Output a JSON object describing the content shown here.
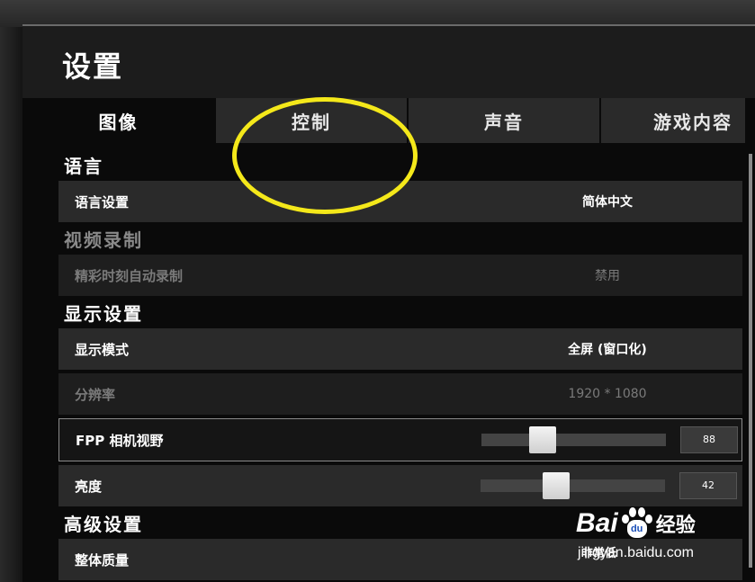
{
  "header": {
    "title": "设置"
  },
  "tabs": [
    {
      "label": "图像",
      "active": true
    },
    {
      "label": "控制",
      "active": false
    },
    {
      "label": "声音",
      "active": false
    },
    {
      "label": "游戏内容",
      "active": false
    }
  ],
  "sections": {
    "language": {
      "title": "语言",
      "rows": [
        {
          "label": "语言设置",
          "value": "简体中文"
        }
      ]
    },
    "video_record": {
      "title": "视频录制",
      "rows": [
        {
          "label": "精彩时刻自动录制",
          "value": "禁用"
        }
      ]
    },
    "display": {
      "title": "显示设置",
      "rows": [
        {
          "label": "显示模式",
          "value": "全屏 (窗口化)"
        },
        {
          "label": "分辨率",
          "value": "1920 * 1080"
        },
        {
          "label": "FPP 相机视野",
          "value": "88",
          "slider_percent": 33
        },
        {
          "label": "亮度",
          "value": "42",
          "slider_percent": 41
        }
      ]
    },
    "advanced": {
      "title": "高级设置",
      "rows": [
        {
          "label": "整体质量",
          "value": "非常低"
        }
      ]
    }
  },
  "watermark": {
    "brand_left": "Bai",
    "brand_mid": "du",
    "brand_right": "经验",
    "url": "jingyan.baidu.com"
  },
  "colors": {
    "highlight": "#f4e81a",
    "panel": "#0a0a0a",
    "row": "#2a2a2a"
  }
}
